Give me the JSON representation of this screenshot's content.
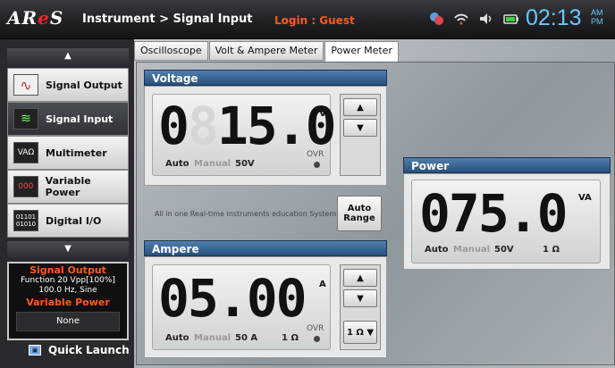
{
  "app": {
    "logo_prefix": "AR",
    "logo_o": "e",
    "logo_suffix": "S",
    "breadcrumb": "Instrument > Signal Input",
    "login": "Login  :  Guest",
    "clock": "02:13",
    "ampm_top": "AM",
    "ampm_bottom": "PM"
  },
  "status_icons": [
    "user-icon",
    "wifi-icon",
    "speaker-icon",
    "battery-icon"
  ],
  "sidebar": {
    "up": "▲",
    "down": "▼",
    "items": [
      {
        "label": "Signal Output",
        "icon": "sine-wave-icon",
        "glyph": "∿"
      },
      {
        "label": "Signal Input",
        "icon": "oscilloscope-icon",
        "glyph": "≋"
      },
      {
        "label": "Multimeter",
        "icon": "multimeter-icon",
        "glyph": "VAΩ"
      },
      {
        "label": "Variable Power",
        "icon": "power-supply-icon",
        "glyph": "000"
      },
      {
        "label": "Digital I/O",
        "icon": "binary-icon",
        "glyph": "01101"
      }
    ],
    "info": {
      "signal_title": "Signal Output",
      "signal_line1": "Function 20 Vpp[100%]",
      "signal_line2": "100.0 Hz, Sine",
      "power_title": "Variable Power",
      "power_value": "None"
    },
    "quick_launch": "Quick Launch"
  },
  "tabs": [
    "Oscilloscope",
    "Volt & Ampere Meter",
    "Power Meter"
  ],
  "active_tab": "Power Meter",
  "voltage": {
    "title": "Voltage",
    "ghost": "8",
    "value_a": "0",
    "value_b": "15.0",
    "unit": "V",
    "auto": "Auto",
    "manual": "Manual",
    "range": "50V",
    "ovr": "OVR"
  },
  "auto_range": {
    "line1": "Auto",
    "line2": "Range"
  },
  "system_text": "All in one Real-time instruments education System",
  "ampere": {
    "title": "Ampere",
    "value": "05.00",
    "unit": "A",
    "auto": "Auto",
    "manual": "Manual",
    "range": "50 A",
    "ohm": "1  Ω",
    "ovr": "OVR",
    "ohm_select": "1 Ω ▼"
  },
  "power": {
    "title": "Power",
    "value": "075.0",
    "unit": "VA",
    "auto": "Auto",
    "manual": "Manual",
    "range": "50V",
    "ohm": "1   Ω"
  },
  "arrows": {
    "up": "▲",
    "down": "▼"
  }
}
